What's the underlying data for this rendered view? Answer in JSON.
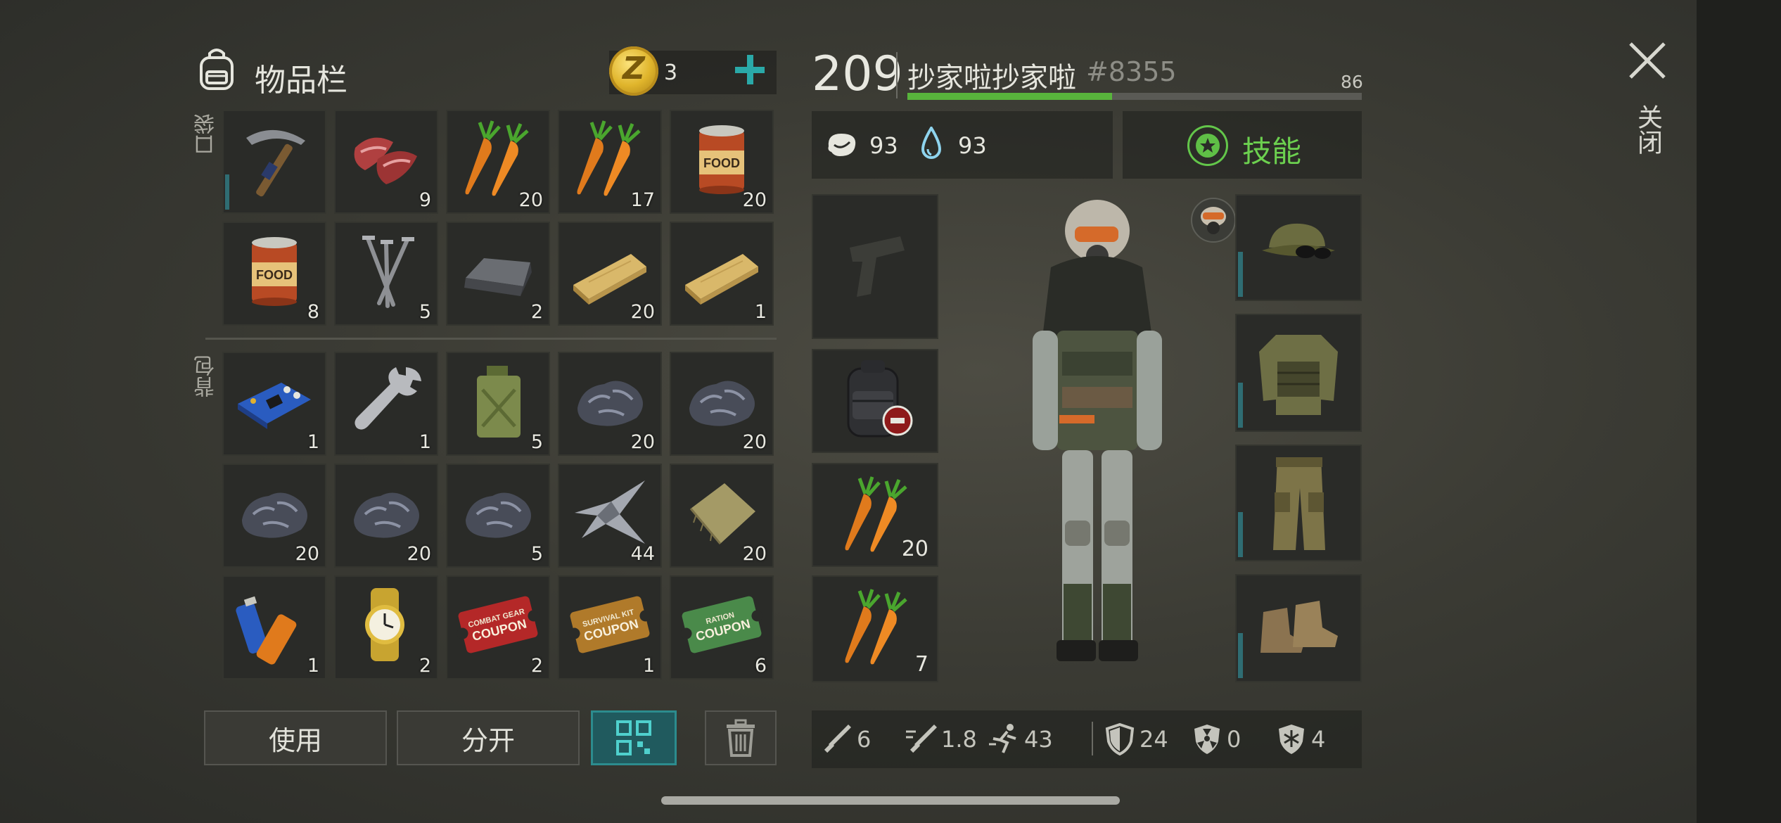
{
  "header": {
    "inventory_title": "物品栏",
    "coin_symbol": "Z",
    "coin_count": "3",
    "close_label": "关闭"
  },
  "sections": {
    "pockets_label": "口袋",
    "backpack_label": "背包"
  },
  "pocket_items": [
    {
      "icon": "pickaxe-icon",
      "count": ""
    },
    {
      "icon": "raw-meat-icon",
      "count": "9"
    },
    {
      "icon": "carrot-icon",
      "count": "20"
    },
    {
      "icon": "carrot-icon",
      "count": "17"
    },
    {
      "icon": "canned-food-icon",
      "count": "20"
    },
    {
      "icon": "canned-food-icon",
      "count": "8"
    },
    {
      "icon": "nails-icon",
      "count": "5"
    },
    {
      "icon": "iron-ingot-icon",
      "count": "2"
    },
    {
      "icon": "wood-plank-icon",
      "count": "20"
    },
    {
      "icon": "wood-plank-icon",
      "count": "1"
    }
  ],
  "backpack_items": [
    {
      "icon": "circuit-board-icon",
      "count": "1"
    },
    {
      "icon": "wrench-icon",
      "count": "1"
    },
    {
      "icon": "jerrycan-icon",
      "count": "5"
    },
    {
      "icon": "iron-ore-icon",
      "count": "20"
    },
    {
      "icon": "iron-ore-icon",
      "count": "20"
    },
    {
      "icon": "iron-ore-icon",
      "count": "20"
    },
    {
      "icon": "iron-ore-icon",
      "count": "20"
    },
    {
      "icon": "iron-ore-icon",
      "count": "5"
    },
    {
      "icon": "scrap-metal-icon",
      "count": "44"
    },
    {
      "icon": "cloth-icon",
      "count": "20"
    },
    {
      "icon": "batteries-icon",
      "count": "1"
    },
    {
      "icon": "gold-watch-icon",
      "count": "2"
    },
    {
      "icon": "combat-gear-coupon-icon",
      "count": "2",
      "coupon_top": "COMBAT GEAR",
      "coupon_main": "COUPON"
    },
    {
      "icon": "survival-kit-coupon-icon",
      "count": "1",
      "coupon_top": "SURVIVAL KIT",
      "coupon_main": "COUPON"
    },
    {
      "icon": "ration-coupon-icon",
      "count": "6",
      "coupon_top": "RATION",
      "coupon_main": "COUPON"
    }
  ],
  "buttons": {
    "use": "使用",
    "split": "分开"
  },
  "player": {
    "level": "209",
    "name": "抄家啦抄家啦",
    "tag": "#8355",
    "xp_value": "86",
    "xp_fraction": 0.45,
    "hunger": "93",
    "thirst": "93",
    "skills_label": "技能"
  },
  "quick_slots": [
    {
      "icon": "pistol-placeholder-icon",
      "count": ""
    },
    {
      "icon": "backpack-icon",
      "count": ""
    },
    {
      "icon": "carrot-icon",
      "count": "20"
    },
    {
      "icon": "carrot-icon",
      "count": "7"
    }
  ],
  "equipment": [
    {
      "icon": "camo-hat-icon"
    },
    {
      "icon": "camo-jacket-icon"
    },
    {
      "icon": "camo-pants-icon"
    },
    {
      "icon": "boots-icon"
    }
  ],
  "combat_stats": {
    "attack": "6",
    "attack_speed": "1.8",
    "move_speed": "43",
    "defense": "24",
    "radiation": "0",
    "cold": "4"
  },
  "colors": {
    "accent_teal": "#2c8c8e",
    "xp_green": "#58b43c",
    "skill_green": "#6cd04f"
  }
}
